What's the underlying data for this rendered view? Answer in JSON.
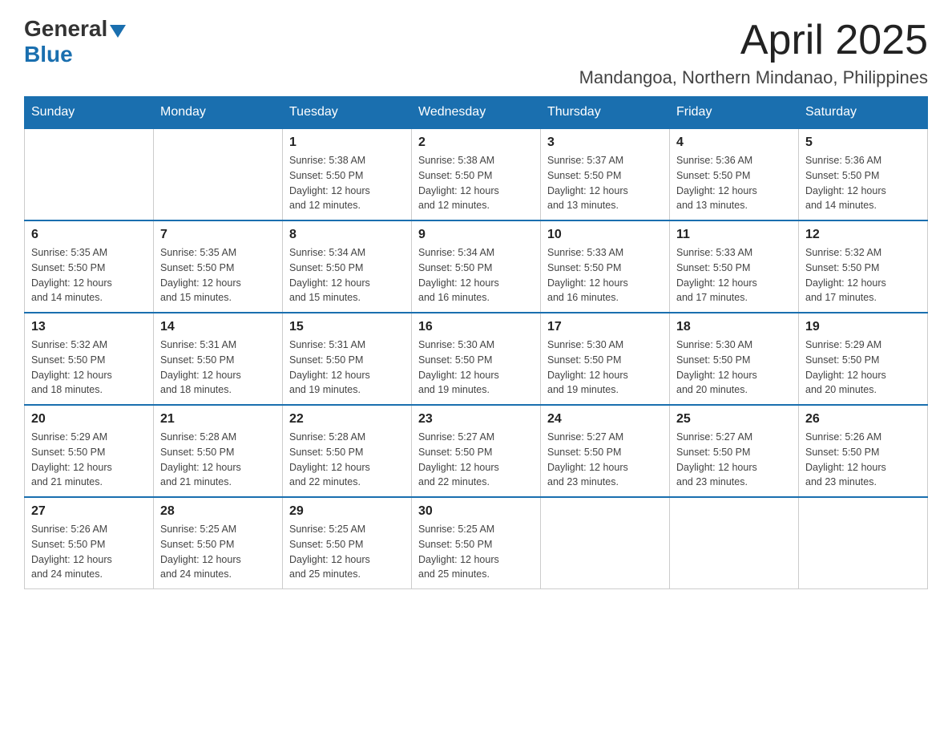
{
  "header": {
    "logo_general": "General",
    "logo_blue": "Blue",
    "month_year": "April 2025",
    "location": "Mandangoa, Northern Mindanao, Philippines"
  },
  "days_of_week": [
    "Sunday",
    "Monday",
    "Tuesday",
    "Wednesday",
    "Thursday",
    "Friday",
    "Saturday"
  ],
  "weeks": [
    [
      {
        "day": "",
        "info": ""
      },
      {
        "day": "",
        "info": ""
      },
      {
        "day": "1",
        "info": "Sunrise: 5:38 AM\nSunset: 5:50 PM\nDaylight: 12 hours\nand 12 minutes."
      },
      {
        "day": "2",
        "info": "Sunrise: 5:38 AM\nSunset: 5:50 PM\nDaylight: 12 hours\nand 12 minutes."
      },
      {
        "day": "3",
        "info": "Sunrise: 5:37 AM\nSunset: 5:50 PM\nDaylight: 12 hours\nand 13 minutes."
      },
      {
        "day": "4",
        "info": "Sunrise: 5:36 AM\nSunset: 5:50 PM\nDaylight: 12 hours\nand 13 minutes."
      },
      {
        "day": "5",
        "info": "Sunrise: 5:36 AM\nSunset: 5:50 PM\nDaylight: 12 hours\nand 14 minutes."
      }
    ],
    [
      {
        "day": "6",
        "info": "Sunrise: 5:35 AM\nSunset: 5:50 PM\nDaylight: 12 hours\nand 14 minutes."
      },
      {
        "day": "7",
        "info": "Sunrise: 5:35 AM\nSunset: 5:50 PM\nDaylight: 12 hours\nand 15 minutes."
      },
      {
        "day": "8",
        "info": "Sunrise: 5:34 AM\nSunset: 5:50 PM\nDaylight: 12 hours\nand 15 minutes."
      },
      {
        "day": "9",
        "info": "Sunrise: 5:34 AM\nSunset: 5:50 PM\nDaylight: 12 hours\nand 16 minutes."
      },
      {
        "day": "10",
        "info": "Sunrise: 5:33 AM\nSunset: 5:50 PM\nDaylight: 12 hours\nand 16 minutes."
      },
      {
        "day": "11",
        "info": "Sunrise: 5:33 AM\nSunset: 5:50 PM\nDaylight: 12 hours\nand 17 minutes."
      },
      {
        "day": "12",
        "info": "Sunrise: 5:32 AM\nSunset: 5:50 PM\nDaylight: 12 hours\nand 17 minutes."
      }
    ],
    [
      {
        "day": "13",
        "info": "Sunrise: 5:32 AM\nSunset: 5:50 PM\nDaylight: 12 hours\nand 18 minutes."
      },
      {
        "day": "14",
        "info": "Sunrise: 5:31 AM\nSunset: 5:50 PM\nDaylight: 12 hours\nand 18 minutes."
      },
      {
        "day": "15",
        "info": "Sunrise: 5:31 AM\nSunset: 5:50 PM\nDaylight: 12 hours\nand 19 minutes."
      },
      {
        "day": "16",
        "info": "Sunrise: 5:30 AM\nSunset: 5:50 PM\nDaylight: 12 hours\nand 19 minutes."
      },
      {
        "day": "17",
        "info": "Sunrise: 5:30 AM\nSunset: 5:50 PM\nDaylight: 12 hours\nand 19 minutes."
      },
      {
        "day": "18",
        "info": "Sunrise: 5:30 AM\nSunset: 5:50 PM\nDaylight: 12 hours\nand 20 minutes."
      },
      {
        "day": "19",
        "info": "Sunrise: 5:29 AM\nSunset: 5:50 PM\nDaylight: 12 hours\nand 20 minutes."
      }
    ],
    [
      {
        "day": "20",
        "info": "Sunrise: 5:29 AM\nSunset: 5:50 PM\nDaylight: 12 hours\nand 21 minutes."
      },
      {
        "day": "21",
        "info": "Sunrise: 5:28 AM\nSunset: 5:50 PM\nDaylight: 12 hours\nand 21 minutes."
      },
      {
        "day": "22",
        "info": "Sunrise: 5:28 AM\nSunset: 5:50 PM\nDaylight: 12 hours\nand 22 minutes."
      },
      {
        "day": "23",
        "info": "Sunrise: 5:27 AM\nSunset: 5:50 PM\nDaylight: 12 hours\nand 22 minutes."
      },
      {
        "day": "24",
        "info": "Sunrise: 5:27 AM\nSunset: 5:50 PM\nDaylight: 12 hours\nand 23 minutes."
      },
      {
        "day": "25",
        "info": "Sunrise: 5:27 AM\nSunset: 5:50 PM\nDaylight: 12 hours\nand 23 minutes."
      },
      {
        "day": "26",
        "info": "Sunrise: 5:26 AM\nSunset: 5:50 PM\nDaylight: 12 hours\nand 23 minutes."
      }
    ],
    [
      {
        "day": "27",
        "info": "Sunrise: 5:26 AM\nSunset: 5:50 PM\nDaylight: 12 hours\nand 24 minutes."
      },
      {
        "day": "28",
        "info": "Sunrise: 5:25 AM\nSunset: 5:50 PM\nDaylight: 12 hours\nand 24 minutes."
      },
      {
        "day": "29",
        "info": "Sunrise: 5:25 AM\nSunset: 5:50 PM\nDaylight: 12 hours\nand 25 minutes."
      },
      {
        "day": "30",
        "info": "Sunrise: 5:25 AM\nSunset: 5:50 PM\nDaylight: 12 hours\nand 25 minutes."
      },
      {
        "day": "",
        "info": ""
      },
      {
        "day": "",
        "info": ""
      },
      {
        "day": "",
        "info": ""
      }
    ]
  ]
}
